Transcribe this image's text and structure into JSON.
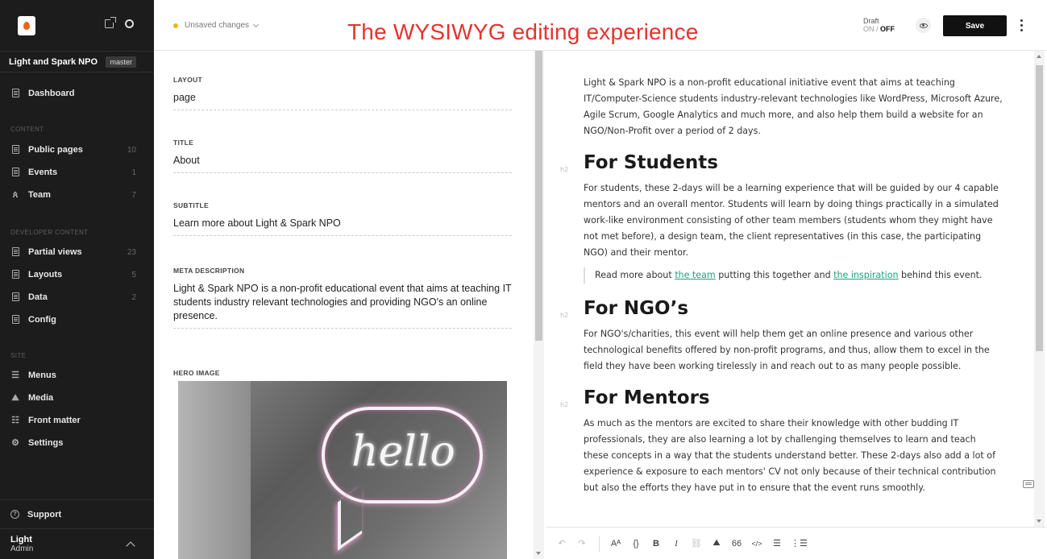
{
  "sidebar": {
    "site_name": "Light and Spark NPO",
    "branch": "master",
    "dashboard": "Dashboard",
    "sections": {
      "content": "CONTENT",
      "developer": "DEVELOPER CONTENT",
      "site": "SITE"
    },
    "content_items": [
      {
        "label": "Public pages",
        "count": "10"
      },
      {
        "label": "Events",
        "count": "1"
      },
      {
        "label": "Team",
        "count": "7"
      }
    ],
    "developer_items": [
      {
        "label": "Partial views",
        "count": "23"
      },
      {
        "label": "Layouts",
        "count": "5"
      },
      {
        "label": "Data",
        "count": "2"
      },
      {
        "label": "Config",
        "count": ""
      }
    ],
    "site_items": [
      {
        "label": "Menus"
      },
      {
        "label": "Media"
      },
      {
        "label": "Front matter"
      },
      {
        "label": "Settings"
      }
    ],
    "support": "Support",
    "user_name": "Light",
    "user_role": "Admin"
  },
  "topbar": {
    "status": "Unsaved changes",
    "overlay_title": "The WYSIWYG editing experience",
    "draft_label": "Draft",
    "draft_on": "ON",
    "draft_sep": "/",
    "draft_off": "OFF",
    "save_label": "Save"
  },
  "form": {
    "layout": {
      "label": "LAYOUT",
      "value": "page"
    },
    "title": {
      "label": "TITLE",
      "value": "About"
    },
    "subtitle": {
      "label": "SUBTITLE",
      "value": "Learn more about Light & Spark NPO"
    },
    "meta": {
      "label": "META DESCRIPTION",
      "value": "Light & Spark NPO is a non-profit educational event that aims at teaching IT students industry relevant technologies and providing NGO's an online presence."
    },
    "hero": {
      "label": "HERO IMAGE",
      "image_text": "hello"
    }
  },
  "editor": {
    "intro": "Light & Spark NPO is a non-profit educational initiative event that aims at teaching IT/Computer-Science students industry-relevant technologies like WordPress, Microsoft Azure, Agile Scrum, Google Analytics and much more, and also help them build a website for an NGO/Non-Profit over a period of 2 days.",
    "h2_tag": "h2",
    "students_heading": "For Students",
    "students_text": "For students, these 2-days will be a learning experience that will be guided by our 4 capable mentors and an overall mentor. Students will learn by doing things practically in a simulated work-like environment consisting of other team members (students whom they might have not met before), a design team, the client representatives (in this case, the participating NGO) and their mentor.",
    "quote_prefix": "Read more about ",
    "quote_link1": "the team",
    "quote_mid": " putting this together and ",
    "quote_link2": "the inspiration",
    "quote_suffix": " behind this event.",
    "ngo_heading": "For NGO’s",
    "ngo_text": "For NGO's/charities, this event will help them get an online presence and various other technological benefits offered by non-profit programs, and thus, allow them to excel in the field they have been working tirelessly in and reach out to as many people possible.",
    "mentors_heading": "For Mentors",
    "mentors_text": "As much as the mentors are excited to share their knowledge with other budding IT professionals, they are also learning a lot by challenging themselves to learn and teach these concepts in a way that the students understand better. These 2-days also add a lot of experience & exposure to each mentors' CV not only because of their technical contribution but also the efforts they have put in to ensure that the event runs smoothly."
  },
  "toolbar": {
    "undo": "↶",
    "redo": "↷",
    "font_size": "Aᴬ",
    "code": "{}",
    "bold": "B",
    "italic": "I",
    "link": "⛓",
    "image": "⛰",
    "quote": "66",
    "code_block": "</>",
    "bullet_list": "☰",
    "numbered_list": "⋮☰"
  },
  "colors": {
    "sidebar_bg": "#1c1c1c",
    "accent_link": "#1da27a",
    "status_dot": "#e8b523",
    "overlay_title": "#e8322d",
    "save_bg": "#111111"
  }
}
